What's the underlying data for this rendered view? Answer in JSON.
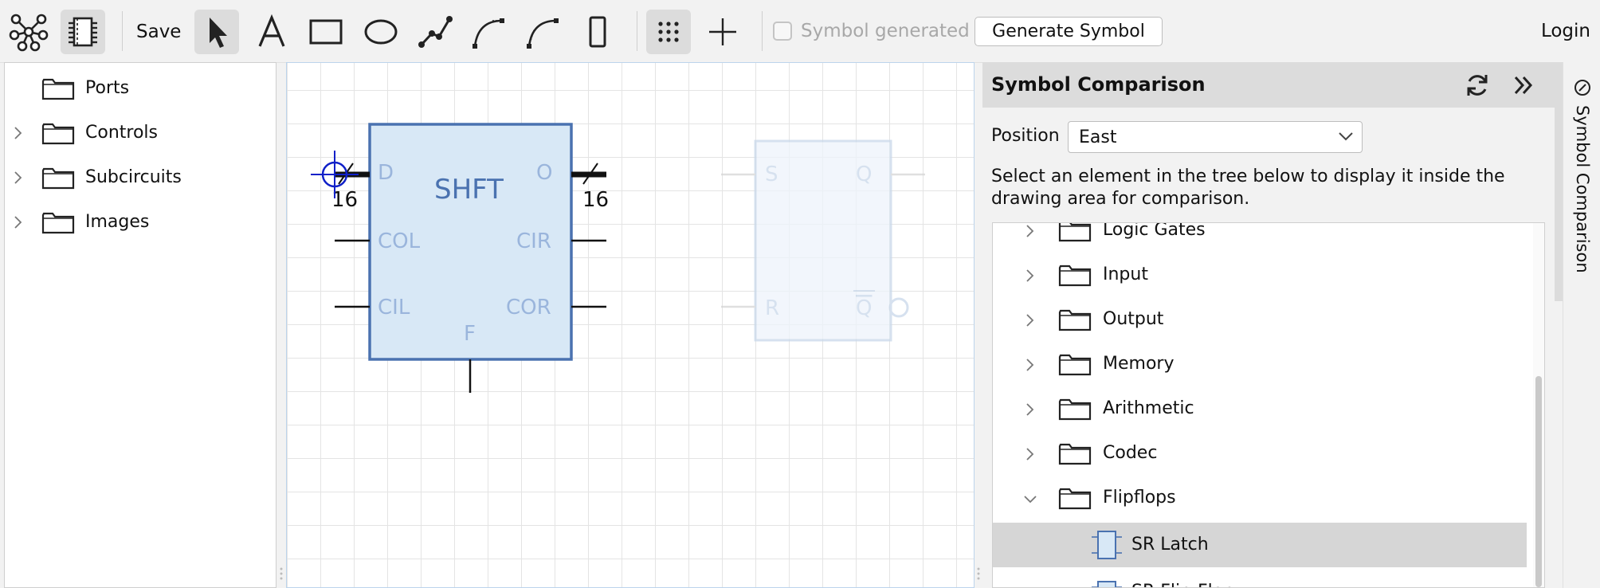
{
  "toolbar": {
    "save_label": "Save",
    "symbol_generated_label": "Symbol generated",
    "symbol_generated_checked": false,
    "generate_symbol_label": "Generate Symbol",
    "login_label": "Login"
  },
  "left_tree": {
    "items": [
      {
        "label": "Ports",
        "expandable": false
      },
      {
        "label": "Controls",
        "expandable": true
      },
      {
        "label": "Subcircuits",
        "expandable": true
      },
      {
        "label": "Images",
        "expandable": true
      }
    ]
  },
  "canvas": {
    "main_symbol": {
      "title": "SHFT",
      "pin_d": "D",
      "pin_o": "O",
      "pin_col": "COL",
      "pin_cir": "CIR",
      "pin_cil": "CIL",
      "pin_cor": "COR",
      "pin_f": "F",
      "bus_width_in": "16",
      "bus_width_out": "16"
    },
    "compare_symbol": {
      "pin_s": "S",
      "pin_q": "Q",
      "pin_r": "R",
      "pin_qbar": "Q"
    }
  },
  "right_panel": {
    "title": "Symbol Comparison",
    "position_label": "Position",
    "position_value": "East",
    "description": "Select an element in the tree below to display it inside the drawing area for comparison.",
    "tree": [
      {
        "label": "Logic Gates",
        "type": "folder",
        "expanded": false
      },
      {
        "label": "Input",
        "type": "folder",
        "expanded": false
      },
      {
        "label": "Output",
        "type": "folder",
        "expanded": false
      },
      {
        "label": "Memory",
        "type": "folder",
        "expanded": false
      },
      {
        "label": "Arithmetic",
        "type": "folder",
        "expanded": false
      },
      {
        "label": "Codec",
        "type": "folder",
        "expanded": false
      },
      {
        "label": "Flipflops",
        "type": "folder",
        "expanded": true
      },
      {
        "label": "SR Latch",
        "type": "element",
        "selected": true
      },
      {
        "label": "SR Flip-Flop",
        "type": "element",
        "selected": false
      }
    ]
  },
  "side_tab": {
    "label": "Symbol Comparison"
  },
  "colors": {
    "accent_selected": "#d6d6d6",
    "symbol_fill": "#d8e8f6",
    "symbol_stroke": "#4a72b0",
    "symbol_text": "#4a72b0",
    "pin_text": "#9ab5dc",
    "cursor_blue": "#1020c8"
  }
}
